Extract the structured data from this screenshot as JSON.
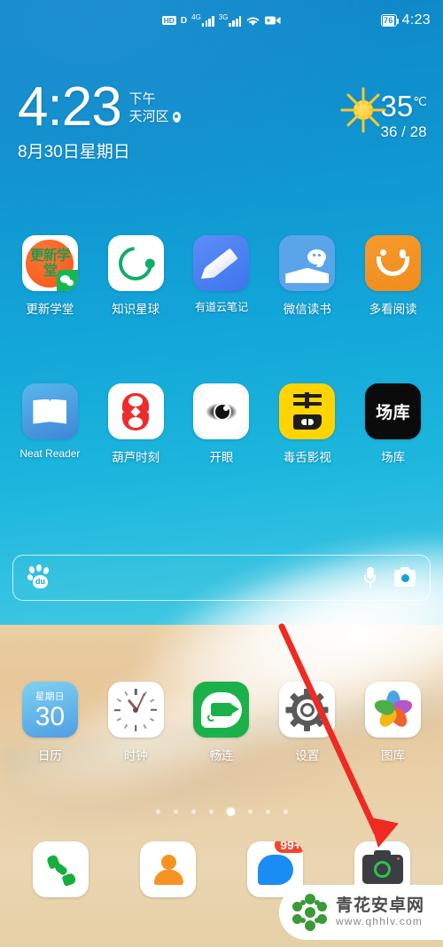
{
  "status_bar": {
    "hd_label": "HD",
    "data_label": "D",
    "network1": "4G",
    "network2": "3G",
    "wifi_icon": "wifi-icon",
    "video_icon": "video-record-icon",
    "battery_level": "76",
    "time": "4:23"
  },
  "widget": {
    "time": "4:23",
    "ampm": "下午",
    "location": "天河区",
    "location_icon": "location-pin-icon",
    "date": "8月30日星期日",
    "weather": {
      "icon": "sun-icon",
      "temp": "35",
      "unit": "℃",
      "high_low": "36 / 28"
    }
  },
  "rows": [
    {
      "apps": [
        {
          "label": "更新学堂",
          "icon": "gengxin-xuetang-icon",
          "icon_text": "更新学堂",
          "badge": "wechat-badge"
        },
        {
          "label": "知识星球",
          "icon": "zhishi-xingqiu-icon"
        },
        {
          "label": "有道云笔记",
          "icon": "youdao-note-icon"
        },
        {
          "label": "微信读书",
          "icon": "weixin-dushu-icon"
        },
        {
          "label": "多看阅读",
          "icon": "duokan-yuedu-icon"
        }
      ]
    },
    {
      "apps": [
        {
          "label": "Neat Reader",
          "icon": "neat-reader-icon"
        },
        {
          "label": "葫芦时刻",
          "icon": "hulu-shike-icon"
        },
        {
          "label": "开眼",
          "icon": "kaiyan-icon"
        },
        {
          "label": "毒舌影视",
          "icon": "dushe-yingshi-icon"
        },
        {
          "label": "场库",
          "icon": "changku-icon",
          "icon_text": "场库"
        }
      ]
    },
    {
      "apps": [
        {
          "label": "日历",
          "icon": "calendar-icon",
          "weekday": "星期日",
          "day": "30"
        },
        {
          "label": "时钟",
          "icon": "clock-icon"
        },
        {
          "label": "畅连",
          "icon": "changlian-icon"
        },
        {
          "label": "设置",
          "icon": "settings-gear-icon"
        },
        {
          "label": "图库",
          "icon": "gallery-icon"
        }
      ]
    }
  ],
  "search": {
    "logo": "baidu-paw-icon",
    "logo_text": "du",
    "mic_icon": "microphone-icon",
    "camera_icon": "camera-icon",
    "placeholder": ""
  },
  "page_indicator": {
    "total": 8,
    "active": 5
  },
  "dock": [
    {
      "label": "phone",
      "icon": "phone-icon"
    },
    {
      "label": "contacts",
      "icon": "contacts-icon"
    },
    {
      "label": "messages",
      "icon": "messages-icon",
      "badge": "99+"
    },
    {
      "label": "camera",
      "icon": "camera-app-icon"
    }
  ],
  "annotation": {
    "type": "arrow",
    "color": "#ee2a23",
    "points_to": "camera-app-icon"
  },
  "watermark": {
    "site_name": "青花安卓网",
    "url": "www.qhhlv.com",
    "logo": "qinghua-network-logo"
  },
  "colors": {
    "accent": "#17a3d6",
    "sand": "#e8cfa4",
    "badge_red": "#f1462e",
    "arrow_red": "#ee2a23"
  }
}
